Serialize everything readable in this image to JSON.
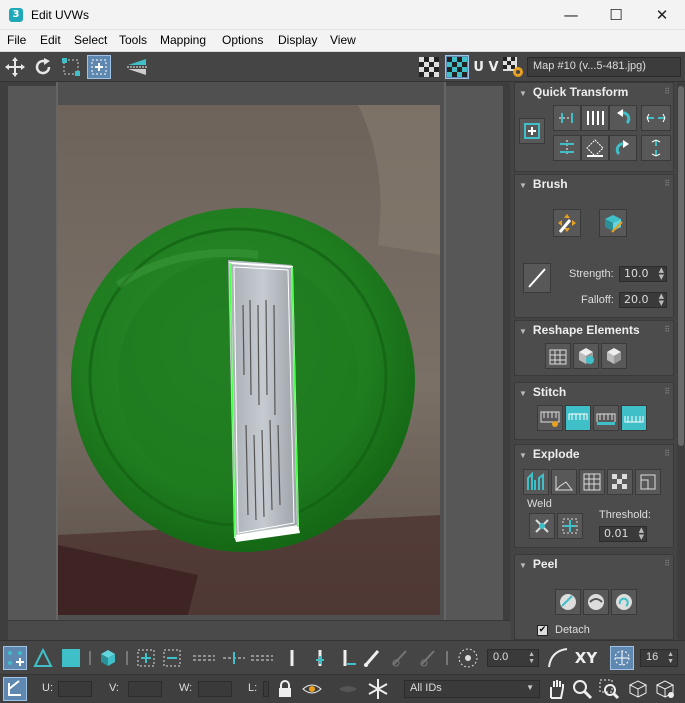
{
  "window": {
    "app_icon": "3",
    "title": "Edit UVWs",
    "minimize": "—",
    "maximize": "☐",
    "close": "✕"
  },
  "menu": [
    "File",
    "Edit",
    "Select",
    "Tools",
    "Mapping",
    "Options",
    "Display",
    "View"
  ],
  "toolbar": {
    "uv_label": "U V",
    "map_dropdown": "Map #10 (v...5-481.jpg)",
    "icons": [
      "move-icon",
      "rotate-icon",
      "freeform-icon",
      "freeform-active-icon",
      "mirror-icon",
      "checker-icon",
      "checker-active-icon",
      "uv-label",
      "map-settings-icon"
    ]
  },
  "panel": {
    "quick_transform": {
      "title": "Quick Transform"
    },
    "brush": {
      "title": "Brush",
      "strength_label": "Strength:",
      "strength_value": "10.0",
      "falloff_label": "Falloff:",
      "falloff_value": "20.0"
    },
    "reshape": {
      "title": "Reshape Elements"
    },
    "stitch": {
      "title": "Stitch"
    },
    "explode": {
      "title": "Explode",
      "weld_label": "Weld",
      "threshold_label": "Threshold:",
      "threshold_value": "0.01"
    },
    "peel": {
      "title": "Peel",
      "detach_label": "Detach",
      "detach_checked": true
    }
  },
  "bottom_toolbar": {
    "value_field": "0.0",
    "xy_label": "XY",
    "count_value": "16"
  },
  "status_bar": {
    "u_label": "U:",
    "v_label": "V:",
    "w_label": "W:",
    "l_label": "L:",
    "ids_dropdown": "All IDs"
  },
  "colors": {
    "accent_teal": "#3fbfc8",
    "plate_green": "#1f8a1f",
    "uv_outline": "#ffffff",
    "uv_edge_green": "#4cff4c"
  }
}
